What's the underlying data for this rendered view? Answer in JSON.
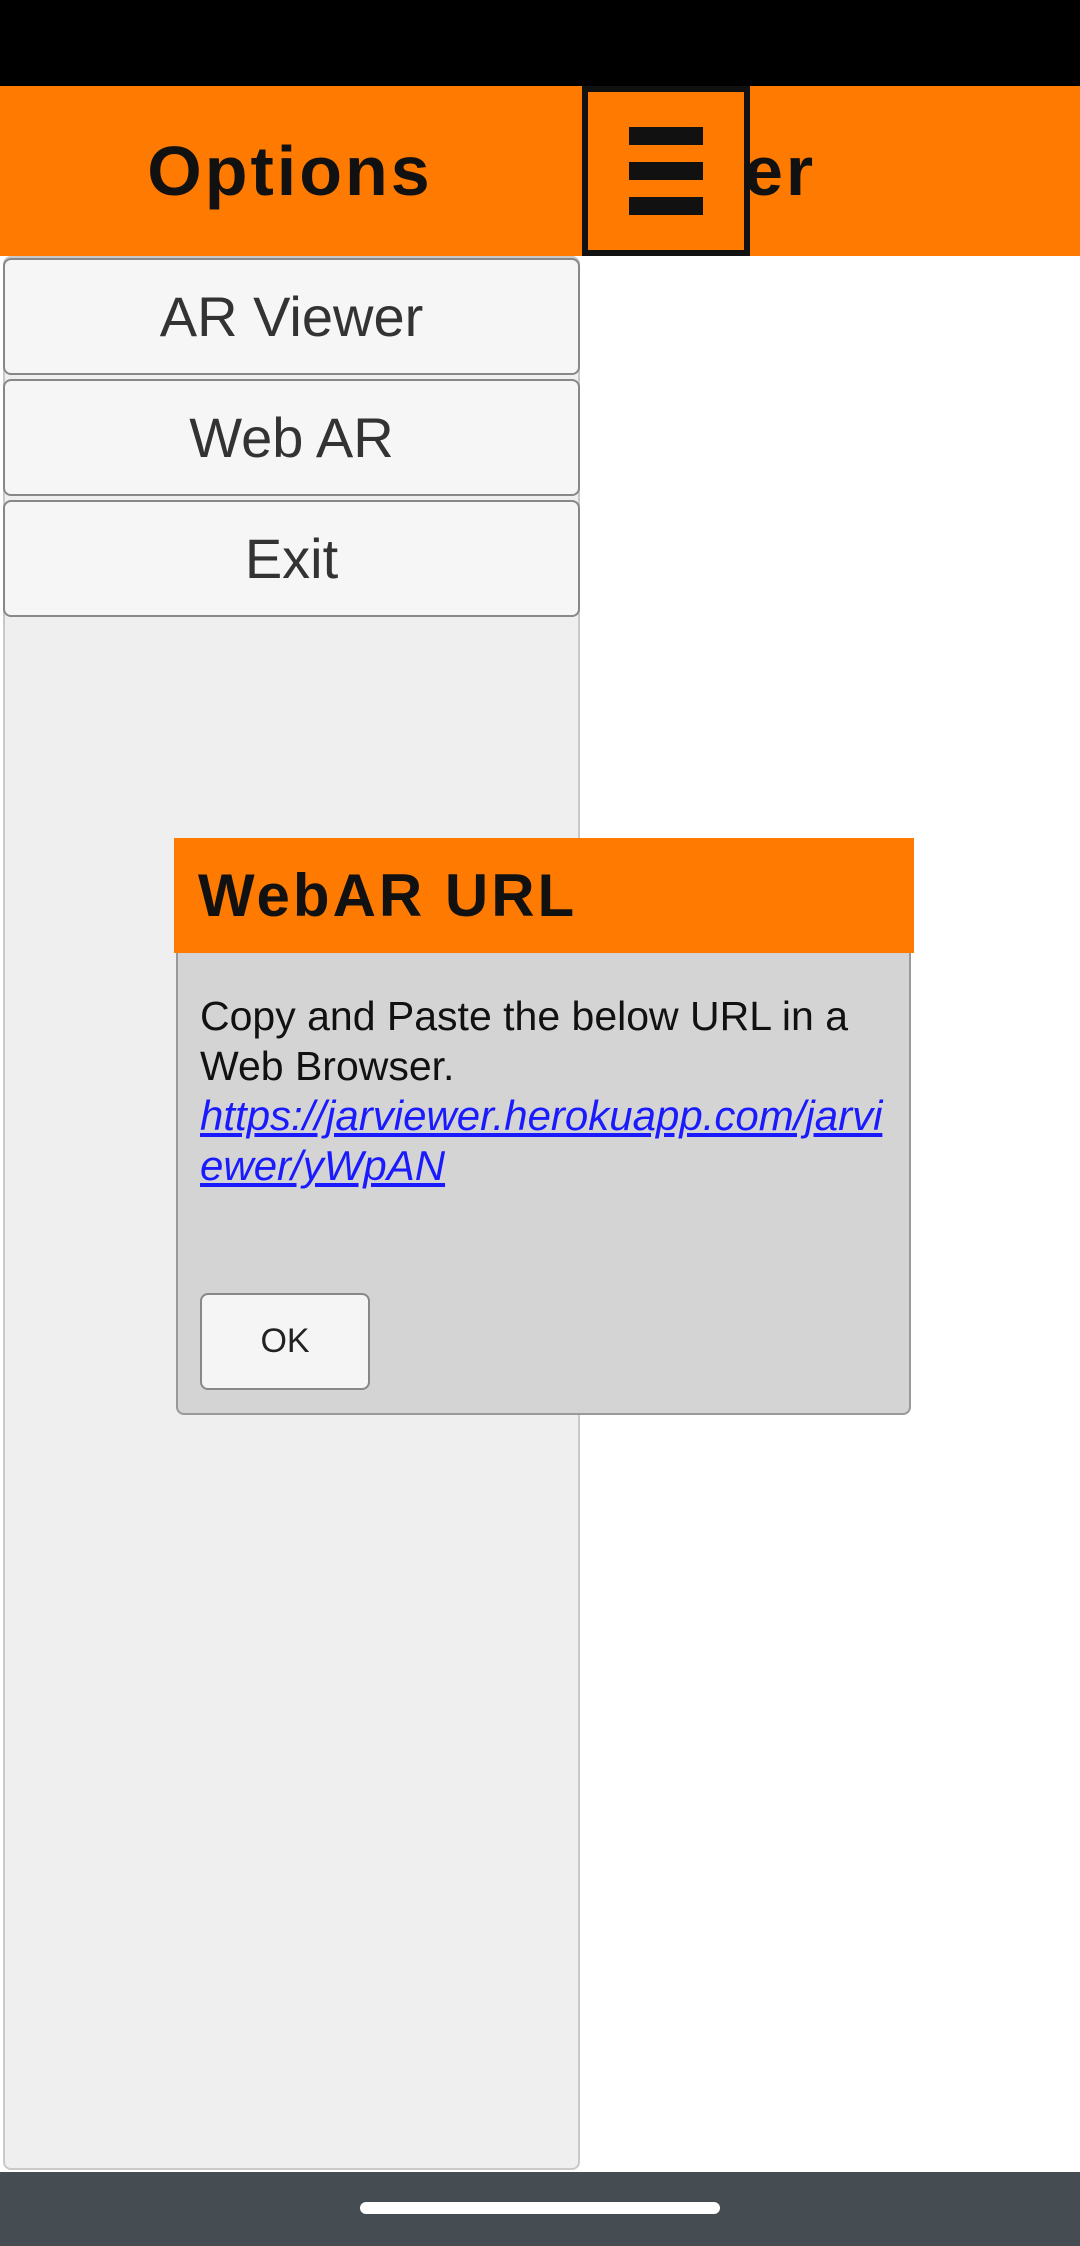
{
  "header": {
    "title_partial": "er",
    "menu_icon": "hamburger-icon"
  },
  "sidebar": {
    "title": "Options",
    "items": [
      {
        "label": "AR Viewer"
      },
      {
        "label": "Web AR"
      },
      {
        "label": "Exit"
      }
    ]
  },
  "dialog": {
    "title": "WebAR URL",
    "message": "Copy and Paste the below URL in a Web Browser.",
    "url": "https://jarviewer.herokuapp.com/jarviewer/yWpAN",
    "ok_label": "OK"
  },
  "colors": {
    "accent": "#ff7a00",
    "status_bar": "#000000",
    "nav_bar": "#454c52",
    "dialog_body": "#d4d4d4",
    "link": "#1a1aff"
  }
}
